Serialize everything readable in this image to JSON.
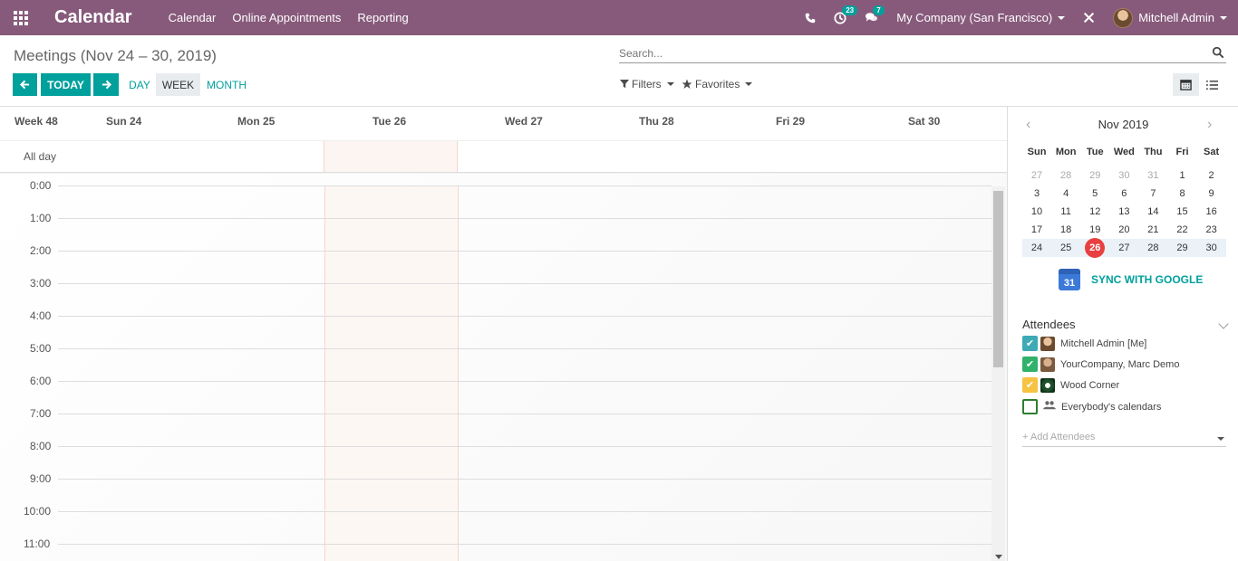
{
  "navbar": {
    "app_title": "Calendar",
    "menu": [
      "Calendar",
      "Online Appointments",
      "Reporting"
    ],
    "activity_count": "23",
    "message_count": "7",
    "company": "My Company (San Francisco)",
    "user": "Mitchell Admin",
    "bg_color": "#875a7b"
  },
  "control": {
    "breadcrumb": "Meetings (Nov 24 – 30, 2019)",
    "today_label": "TODAY",
    "scales": [
      "DAY",
      "WEEK",
      "MONTH"
    ],
    "active_scale": "WEEK",
    "search_placeholder": "Search...",
    "filters_label": "Filters",
    "favorites_label": "Favorites",
    "accent": "#00a09d"
  },
  "calendar": {
    "week_label": "Week 48",
    "days": [
      "Sun 24",
      "Mon 25",
      "Tue 26",
      "Wed 27",
      "Thu 28",
      "Fri 29",
      "Sat 30"
    ],
    "today_index": 2,
    "all_day_label": "All day",
    "hours": [
      "0:00",
      "1:00",
      "2:00",
      "3:00",
      "4:00",
      "5:00",
      "6:00",
      "7:00",
      "8:00",
      "9:00",
      "10:00",
      "11:00"
    ]
  },
  "mini_calendar": {
    "month_label": "Nov 2019",
    "dows": [
      "Sun",
      "Mon",
      "Tue",
      "Wed",
      "Thu",
      "Fri",
      "Sat"
    ],
    "weeks": [
      [
        "27",
        "28",
        "29",
        "30",
        "31",
        "1",
        "2"
      ],
      [
        "3",
        "4",
        "5",
        "6",
        "7",
        "8",
        "9"
      ],
      [
        "10",
        "11",
        "12",
        "13",
        "14",
        "15",
        "16"
      ],
      [
        "17",
        "18",
        "19",
        "20",
        "21",
        "22",
        "23"
      ],
      [
        "24",
        "25",
        "26",
        "27",
        "28",
        "29",
        "30"
      ]
    ],
    "today": "26",
    "sync_label": "SYNC WITH GOOGLE",
    "gcal_icon_text": "31"
  },
  "attendees": {
    "title": "Attendees",
    "items": [
      {
        "name": "Mitchell Admin [Me]",
        "color": "#3daab6",
        "checked": true
      },
      {
        "name": "YourCompany, Marc Demo",
        "color": "#30b26b",
        "checked": true
      },
      {
        "name": "Wood Corner",
        "color": "#f6c342",
        "checked": true
      },
      {
        "name": "Everybody's calendars",
        "color": "#2f7d32",
        "checked": false
      }
    ],
    "add_placeholder": "+ Add Attendees"
  }
}
